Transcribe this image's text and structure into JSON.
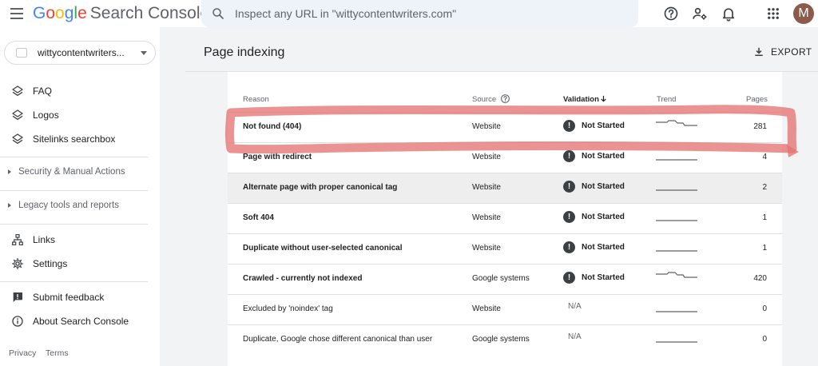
{
  "header": {
    "logo_google": [
      "G",
      "o",
      "o",
      "g",
      "l",
      "e"
    ],
    "logo_product": "Search Console",
    "search_placeholder": "Inspect any URL in \"wittycontentwriters.com\"",
    "avatar_letter": "M"
  },
  "sidebar": {
    "property_name": "wittycontentwriters...",
    "items_top": [
      {
        "label": "FAQ",
        "icon": "layers-icon"
      },
      {
        "label": "Logos",
        "icon": "layers-icon"
      },
      {
        "label": "Sitelinks searchbox",
        "icon": "layers-icon"
      }
    ],
    "sections": [
      {
        "label": "Security & Manual Actions"
      },
      {
        "label": "Legacy tools and reports"
      }
    ],
    "items_mid": [
      {
        "label": "Links",
        "icon": "sitemap-icon"
      },
      {
        "label": "Settings",
        "icon": "gear-icon"
      }
    ],
    "items_bottom": [
      {
        "label": "Submit feedback",
        "icon": "feedback-icon"
      },
      {
        "label": "About Search Console",
        "icon": "info-icon"
      }
    ],
    "footer": {
      "privacy": "Privacy",
      "terms": "Terms"
    }
  },
  "main": {
    "title": "Page indexing",
    "export_label": "EXPORT",
    "columns": {
      "reason": "Reason",
      "source": "Source",
      "validation": "Validation",
      "trend": "Trend",
      "pages": "Pages"
    },
    "rows": [
      {
        "reason": "Not found (404)",
        "source": "Website",
        "validation": "Not Started",
        "status": "not-started",
        "trend": "drop",
        "pages": "281"
      },
      {
        "reason": "Page with redirect",
        "source": "Website",
        "validation": "Not Started",
        "status": "not-started",
        "trend": "flat",
        "pages": "4"
      },
      {
        "reason": "Alternate page with proper canonical tag",
        "source": "Website",
        "validation": "Not Started",
        "status": "not-started",
        "trend": "flat",
        "pages": "2"
      },
      {
        "reason": "Soft 404",
        "source": "Website",
        "validation": "Not Started",
        "status": "not-started",
        "trend": "flat",
        "pages": "1"
      },
      {
        "reason": "Duplicate without user-selected canonical",
        "source": "Website",
        "validation": "Not Started",
        "status": "not-started",
        "trend": "flat",
        "pages": "1"
      },
      {
        "reason": "Crawled - currently not indexed",
        "source": "Google systems",
        "validation": "Not Started",
        "status": "not-started",
        "trend": "drop",
        "pages": "420"
      },
      {
        "reason": "Excluded by 'noindex' tag",
        "source": "Website",
        "validation": "N/A",
        "status": "na",
        "trend": "flat",
        "pages": "0"
      },
      {
        "reason": "Duplicate, Google chose different canonical than user",
        "source": "Google systems",
        "validation": "N/A",
        "status": "na",
        "trend": "flat",
        "pages": "0"
      }
    ]
  },
  "colors": {
    "annotation": "#e57373",
    "highlight_row": "#eeeeee",
    "search_bg": "#eef2f9"
  }
}
